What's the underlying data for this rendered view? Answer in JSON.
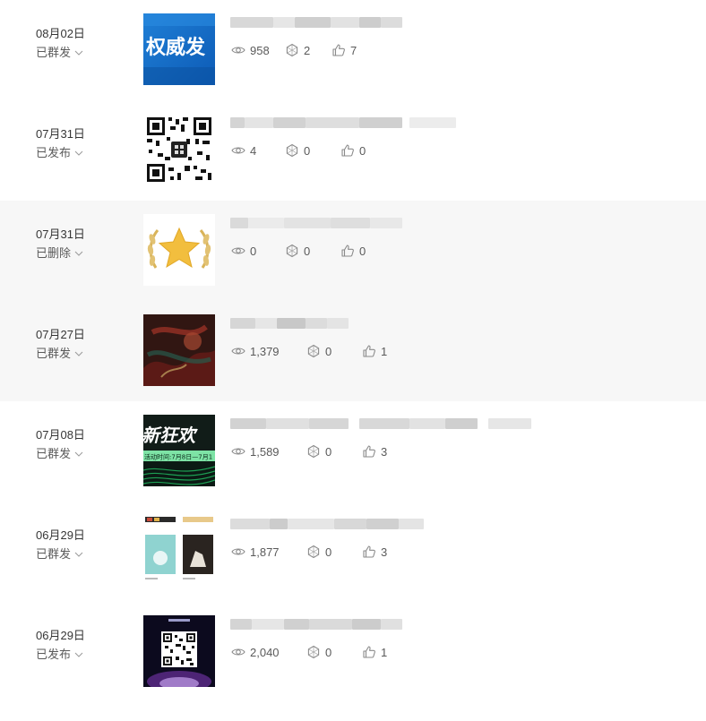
{
  "colors": {
    "text": "#353535",
    "muted": "#5a5a5a",
    "icon": "#8a8a8a",
    "row_highlight": "#f7f7f7"
  },
  "posts": [
    {
      "date": "08月02日",
      "status": "已群发",
      "views": "958",
      "shares": "2",
      "likes": "7",
      "thumb": "blue-banner",
      "thumb_text": "权威发"
    },
    {
      "date": "07月31日",
      "status": "已发布",
      "views": "4",
      "shares": "0",
      "likes": "0",
      "thumb": "qr-code"
    },
    {
      "date": "07月31日",
      "status": "已删除",
      "views": "0",
      "shares": "0",
      "likes": "0",
      "thumb": "gold-star",
      "highlighted": true
    },
    {
      "date": "07月27日",
      "status": "已群发",
      "views": "1,379",
      "shares": "0",
      "likes": "1",
      "thumb": "dark-art",
      "highlighted": true
    },
    {
      "date": "07月08日",
      "status": "已群发",
      "views": "1,589",
      "shares": "0",
      "likes": "3",
      "thumb": "green-banner",
      "thumb_text": "新狂欢",
      "thumb_subtext": "活动时间:7月8日—7月1"
    },
    {
      "date": "06月29日",
      "status": "已群发",
      "views": "1,877",
      "shares": "0",
      "likes": "3",
      "thumb": "poster-collage"
    },
    {
      "date": "06月29日",
      "status": "已发布",
      "views": "2,040",
      "shares": "0",
      "likes": "1",
      "thumb": "dark-qr"
    }
  ]
}
